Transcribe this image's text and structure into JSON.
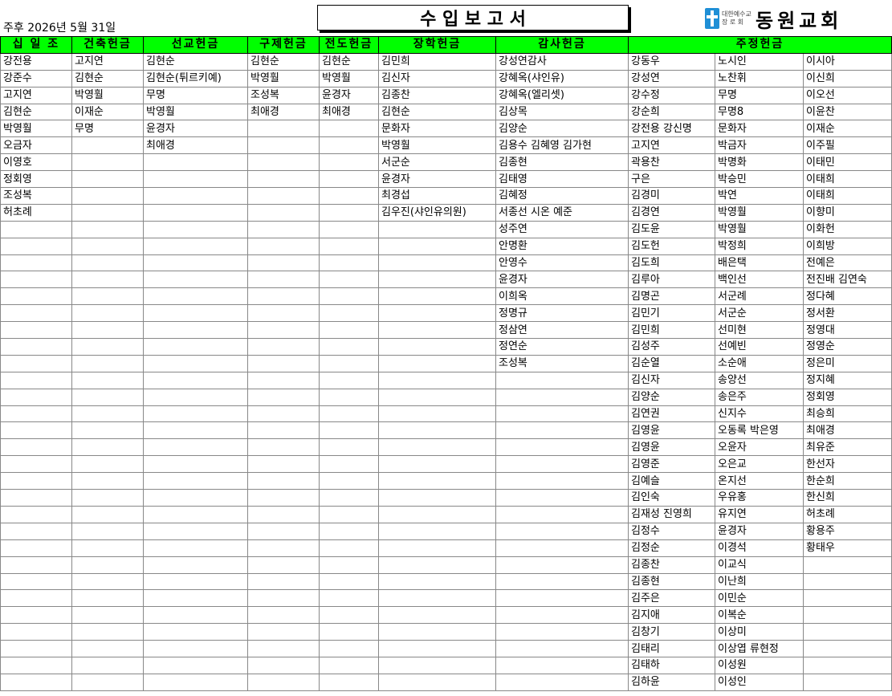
{
  "header": {
    "date": "주후 2026년 5월 31일",
    "title": "수 입 보 고 서",
    "logo_sub_1": "대한예수교",
    "logo_sub_2": "장 로 회",
    "logo_name": "동원교회"
  },
  "columns": [
    "십 일 조",
    "건축헌금",
    "선교헌금",
    "구제헌금",
    "전도헌금",
    "장학헌금",
    "감사헌금",
    "주정헌금"
  ],
  "data": {
    "tithe": [
      "강전용",
      "강준수",
      "고지연",
      "김현순",
      "박영훨",
      "오금자",
      "이영호",
      "정회영",
      "조성복",
      "허초례"
    ],
    "building": [
      "고지연",
      "김현순",
      "박영훨",
      "이재순",
      "무명"
    ],
    "mission": [
      "김현순",
      "김현순(튀르키예)",
      "무명",
      "박영훨",
      "윤경자",
      "최애경"
    ],
    "relief": [
      "김현순",
      "박영훨",
      "조성복",
      "최애경"
    ],
    "evangelism": [
      "김현순",
      "박영훨",
      "윤경자",
      "최애경"
    ],
    "scholarship": [
      "김민희",
      "김신자",
      "김종찬",
      "김현순",
      "문화자",
      "박영훨",
      "서군순",
      "윤경자",
      "최경섭",
      "김우진(샤인유의원)"
    ],
    "thanks": [
      "강성연감사",
      "강혜옥(샤인유)",
      "강혜옥(엘리셋)",
      "김상목",
      "김양순",
      "김용수 김혜영 김가현",
      "김종현",
      "김태영",
      "김혜정",
      "서종선 시온 예준",
      "성주연",
      "안명환",
      "안영수",
      "윤경자",
      "이희옥",
      "정명규",
      "정삼연",
      "정연순",
      "조성복"
    ],
    "weekly_1": [
      "강동우",
      "강성연",
      "강수정",
      "강순희",
      "강전용 강신명",
      "고지연",
      "곽용찬",
      "구은",
      "김경미",
      "김경연",
      "김도윤",
      "김도헌",
      "김도희",
      "김루아",
      "김명곤",
      "김민기",
      "김민희",
      "김성주",
      "김순열",
      "김신자",
      "김양순",
      "김연권",
      "김영윤",
      "김영윤",
      "김영준",
      "김예슬",
      "김인숙",
      "김재성 진영희",
      "김정수",
      "김정순",
      "김종찬",
      "김종현",
      "김주은",
      "김지애",
      "김창기",
      "김태리",
      "김태하",
      "김하윤"
    ],
    "weekly_2": [
      "노시인",
      "노찬휘",
      "무명",
      "무명8",
      "문화자",
      "박금자",
      "박명화",
      "박승민",
      "박연",
      "박영훨",
      "박영훨",
      "박정희",
      "배은택",
      "백인선",
      "서군례",
      "서군순",
      "선미현",
      "선예빈",
      "소순애",
      "송양선",
      "송은주",
      "신지수",
      "오동록 박은영",
      "오윤자",
      "오은교",
      "온지선",
      "우유홍",
      "유지연",
      "윤경자",
      "이경석",
      "이교식",
      "이난희",
      "이민순",
      "이복순",
      "이상미",
      "이상엽 류현정",
      "이성원",
      "이성인"
    ],
    "weekly_3": [
      "이시아",
      "이신희",
      "이오선",
      "이윤찬",
      "이재순",
      "이주필",
      "이태민",
      "이태희",
      "이태희",
      "이향미",
      "이화헌",
      "이희방",
      "전예은",
      "전진배 김연숙",
      "정다혜",
      "정서환",
      "정영대",
      "정영순",
      "정은미",
      "정지혜",
      "정회영",
      "최승희",
      "최애경",
      "최유준",
      "한선자",
      "한순희",
      "한신희",
      "허초례",
      "황용주",
      "황태우"
    ]
  }
}
